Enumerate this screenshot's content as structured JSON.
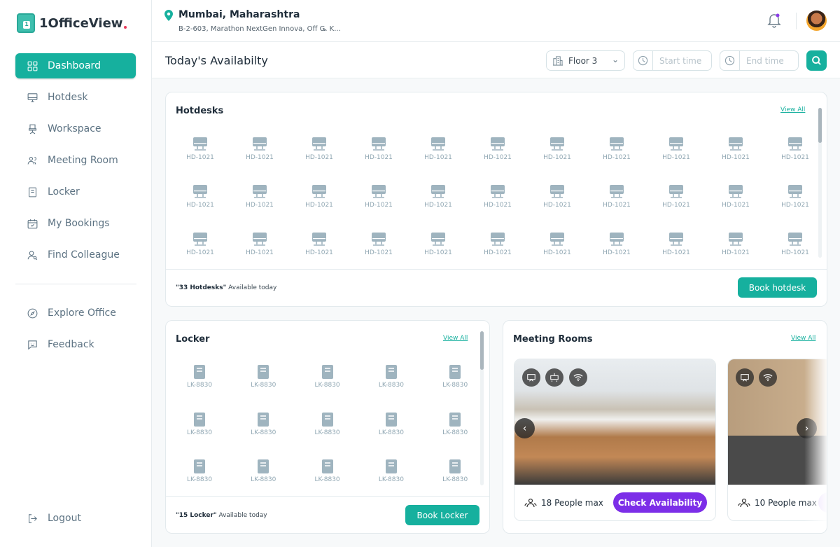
{
  "app": {
    "name": "1OfficeView",
    "logo_digit": "1"
  },
  "sidebar": {
    "items": [
      {
        "label": "Dashboard",
        "icon": "grid-icon",
        "active": true
      },
      {
        "label": "Hotdesk",
        "icon": "monitor-icon"
      },
      {
        "label": "Workspace",
        "icon": "chair-icon"
      },
      {
        "label": "Meeting Room",
        "icon": "users-icon"
      },
      {
        "label": "Locker",
        "icon": "locker-icon"
      },
      {
        "label": "My Bookings",
        "icon": "calendar-check-icon"
      },
      {
        "label": "Find Colleague",
        "icon": "user-search-icon"
      }
    ],
    "secondary": [
      {
        "label": "Explore Office",
        "icon": "compass-icon"
      },
      {
        "label": "Feedback",
        "icon": "feedback-icon"
      }
    ],
    "logout": "Logout"
  },
  "header": {
    "location": "Mumbai, Maharashtra",
    "address": "B-2-603, Marathon NextGen Innova, Off G. K..."
  },
  "subheader": {
    "title": "Today's Availabilty",
    "floor": "Floor 3",
    "start_placeholder": "Start time",
    "end_placeholder": "End time"
  },
  "hotdesks": {
    "title": "Hotdesks",
    "view_all": "View All",
    "count_text": "\"33 Hotdesks\"",
    "available": " Available today",
    "button": "Book hotdesk",
    "items": [
      "HD-1021",
      "HD-1021",
      "HD-1021",
      "HD-1021",
      "HD-1021",
      "HD-1021",
      "HD-1021",
      "HD-1021",
      "HD-1021",
      "HD-1021",
      "HD-1021",
      "HD-1021",
      "HD-1021",
      "HD-1021",
      "HD-1021",
      "HD-1021",
      "HD-1021",
      "HD-1021",
      "HD-1021",
      "HD-1021",
      "HD-1021",
      "HD-1021",
      "HD-1021",
      "HD-1021",
      "HD-1021",
      "HD-1021",
      "HD-1021",
      "HD-1021",
      "HD-1021",
      "HD-1021",
      "HD-1021",
      "HD-1021",
      "HD-1021"
    ]
  },
  "locker": {
    "title": "Locker",
    "view_all": "View All",
    "count_text": "\"15 Locker\"",
    "available": " Available today",
    "button": "Book Locker",
    "items": [
      "LK-8830",
      "LK-8830",
      "LK-8830",
      "LK-8830",
      "LK-8830",
      "LK-8830",
      "LK-8830",
      "LK-8830",
      "LK-8830",
      "LK-8830",
      "LK-8830",
      "LK-8830",
      "LK-8830",
      "LK-8830",
      "LK-8830"
    ]
  },
  "meeting_rooms": {
    "title": "Meeting Rooms",
    "view_all": "View All",
    "rooms": [
      {
        "capacity": "18 People max",
        "button": "Check Availability",
        "amenities": [
          "screen-icon",
          "projector-icon",
          "wifi-icon"
        ]
      },
      {
        "capacity": "10 People max",
        "amenities": [
          "screen-icon",
          "wifi-icon"
        ]
      }
    ]
  },
  "colors": {
    "primary": "#16b09e",
    "accent": "#7c2ee8"
  }
}
